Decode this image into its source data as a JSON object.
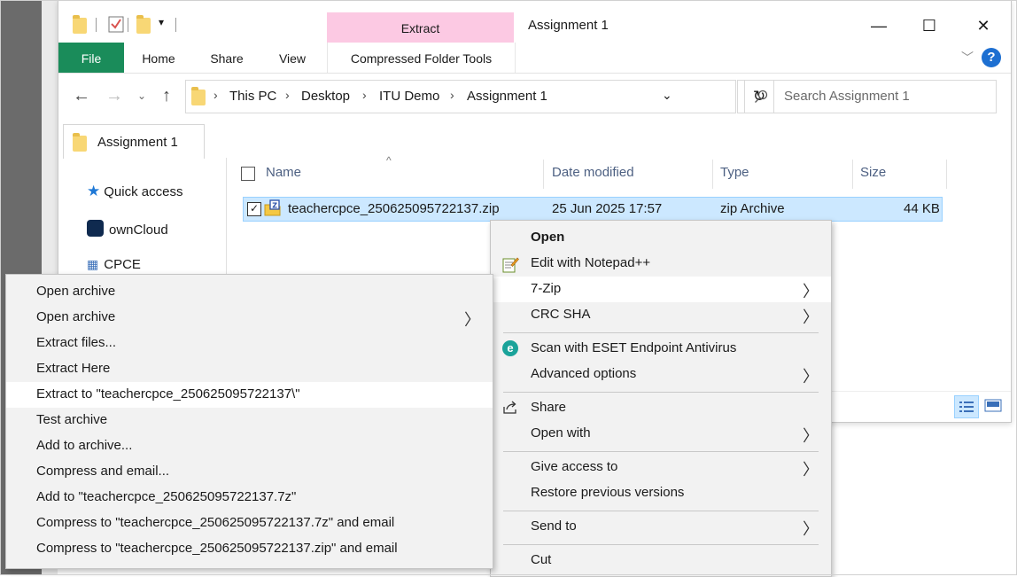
{
  "window": {
    "title": "Assignment 1",
    "minimize": "—",
    "maximize": "☐",
    "close": "✕"
  },
  "ribbon": {
    "contextual_group": "Extract",
    "tabs": [
      "File",
      "Home",
      "Share",
      "View",
      "Compressed Folder Tools"
    ],
    "help": "?"
  },
  "address": {
    "crumbs": [
      "This PC",
      "Desktop",
      "ITU Demo",
      "Assignment 1"
    ],
    "search_placeholder": "Search Assignment 1"
  },
  "folder_tab": {
    "label": "Assignment 1"
  },
  "nav_pane": {
    "items": [
      "Quick access",
      "ownCloud",
      "CPCE"
    ]
  },
  "columns": [
    "Name",
    "Date modified",
    "Type",
    "Size"
  ],
  "files": [
    {
      "name": "teachercpce_250625095722137.zip",
      "date": "25 Jun 2025 17:57",
      "type": "zip Archive",
      "size": "44 KB"
    }
  ],
  "context_menu": {
    "open": "Open",
    "edit_notepad": "Edit with Notepad++",
    "seven_zip": "7-Zip",
    "crc_sha": "CRC SHA",
    "scan_eset": "Scan with ESET Endpoint Antivirus",
    "advanced": "Advanced options",
    "share": "Share",
    "open_with": "Open with",
    "give_access": "Give access to",
    "restore": "Restore previous versions",
    "send_to": "Send to",
    "cut": "Cut"
  },
  "submenu_7zip": [
    "Open archive",
    "Open archive",
    "Extract files...",
    "Extract Here",
    "Extract to \"teachercpce_250625095722137\\\"",
    "Test archive",
    "Add to archive...",
    "Compress and email...",
    "Add to \"teachercpce_250625095722137.7z\"",
    "Compress to \"teachercpce_250625095722137.7z\" and email",
    "Compress to \"teachercpce_250625095722137.zip\" and email"
  ],
  "colors": {
    "file_tab": "#1a8c5a",
    "extract_tab": "#fcc9e3",
    "selection": "#cce8ff",
    "help_icon": "#1d6fd1"
  }
}
